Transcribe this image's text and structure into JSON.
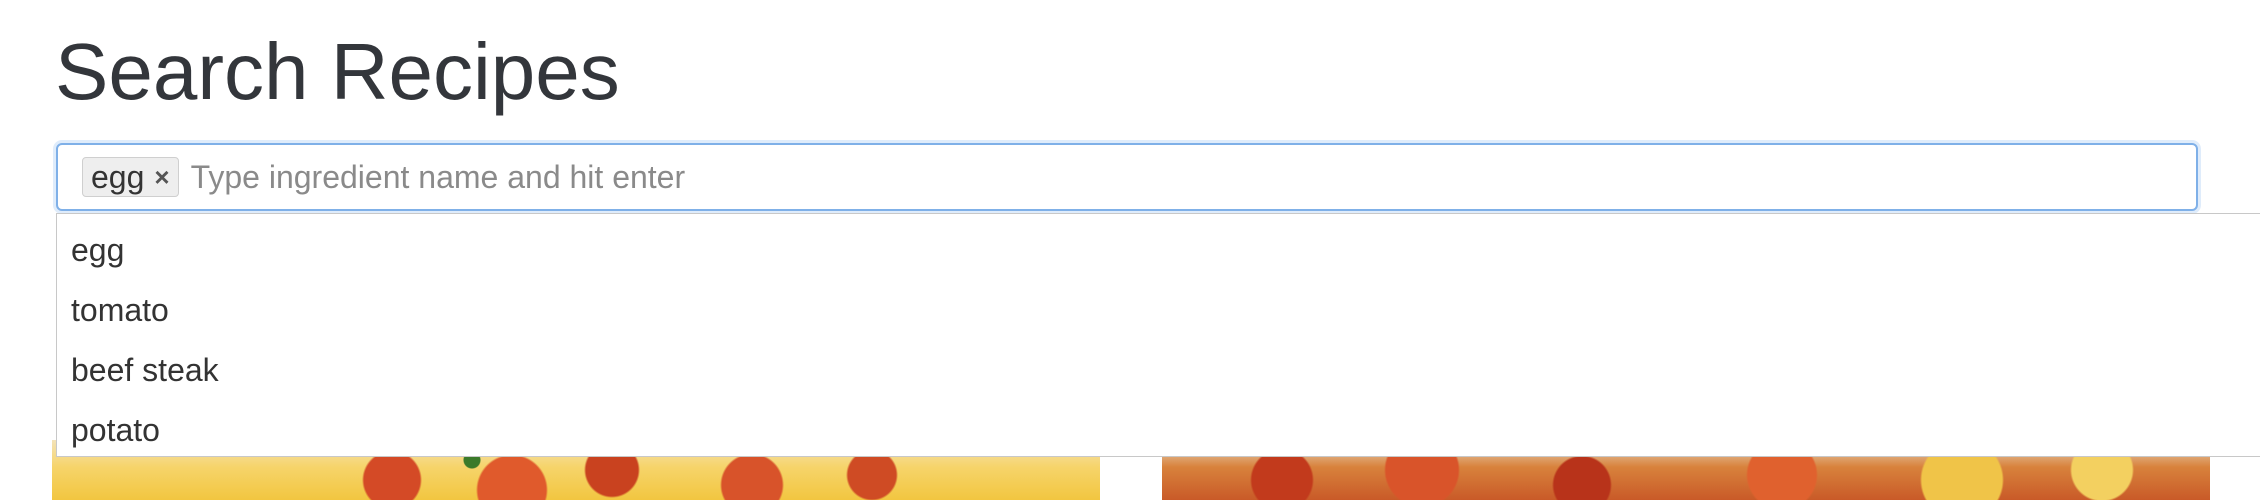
{
  "page": {
    "title": "Search Recipes"
  },
  "search": {
    "placeholder": "Type ingredient name and hit enter",
    "value": "",
    "tags": [
      {
        "label": "egg",
        "remove_glyph": "×"
      }
    ]
  },
  "dropdown": {
    "items": [
      {
        "label": "egg"
      },
      {
        "label": "tomato"
      },
      {
        "label": "beef steak"
      },
      {
        "label": "potato"
      }
    ]
  },
  "colors": {
    "focus_border": "#7fb0e8",
    "title_text": "#33363b",
    "placeholder_text": "#8a8a8a"
  }
}
